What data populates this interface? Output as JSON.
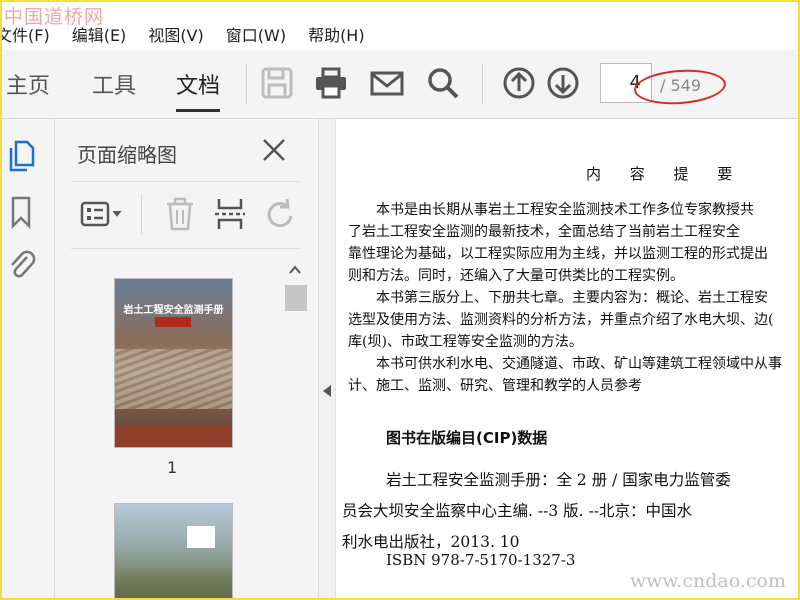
{
  "watermark": {
    "top": "中国道桥网",
    "bottom": "www.cndao.com"
  },
  "menu": [
    "文件(F)",
    "编辑(E)",
    "视图(V)",
    "窗口(W)",
    "帮助(H)"
  ],
  "nav_tabs": [
    "主页",
    "工具",
    "文档"
  ],
  "active_tab": "文档",
  "page_nav": {
    "current": "4",
    "total": "/ 549"
  },
  "panel": {
    "title": "页面缩略图",
    "thumb1_title": "岩土工程安全监测手册",
    "thumb1_num": "1"
  },
  "document": {
    "title": "内 容 提 要",
    "paragraphs": [
      "本书是由长期从事岩土工程安全监测技术工作多位专家教授共",
      "了岩土工程安全监测的最新技术，全面总结了当前岩土工程安全",
      "靠性理论为基础，以工程实际应用为主线，并以监测工程的形式提出",
      "则和方法。同时，还编入了大量可供类比的工程实例。",
      "本书第三版分上、下册共七章。主要内容为：概论、岩土工程安",
      "选型及使用方法、监测资料的分析方法，并重点介绍了水电大坝、边(",
      "库(坝)、市政工程等安全监测的方法。",
      "本书可供水利水电、交通隧道、市政、矿山等建筑工程领域中从事",
      "计、施工、监测、研究、管理和教学的人员参考"
    ],
    "cip_heading": "图书在版编目(CIP)数据",
    "cip_lines": [
      "岩土工程安全监测手册：全 2 册 / 国家电力监管委",
      "员会大坝安全监察中心主编. --3 版. --北京：中国水",
      "利水电出版社，2013. 10"
    ],
    "isbn": "ISBN 978-7-5170-1327-3"
  },
  "colors": {
    "frame": "#f1df3a",
    "annotation": "#d62a2a",
    "rail_active": "#1b6fd6"
  }
}
